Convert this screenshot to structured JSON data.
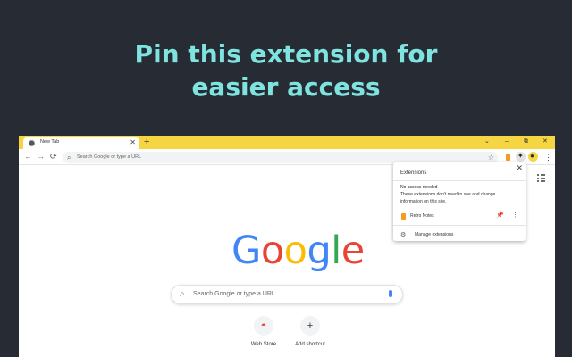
{
  "headline": {
    "line1": "Pin this extension for",
    "line2": "easier access"
  },
  "browser": {
    "tab": {
      "title": "New Tab",
      "close": "✕"
    },
    "newtab": "+",
    "window_controls": {
      "chevron": "⌄",
      "minimize": "–",
      "restore": "⧉",
      "close": "✕"
    },
    "nav": {
      "back": "←",
      "forward": "→",
      "reload": "⟳"
    },
    "omnibox": {
      "search_glyph": "⌕",
      "placeholder": "Search Google or type a URL",
      "star": "☆"
    },
    "toolbar_glyphs": {
      "puzzle": "✦",
      "profile": "●",
      "menu": "⋮"
    }
  },
  "newtab_page": {
    "logo": [
      {
        "ch": "G",
        "color": "#4285f4"
      },
      {
        "ch": "o",
        "color": "#ea4335"
      },
      {
        "ch": "o",
        "color": "#fbbc05"
      },
      {
        "ch": "g",
        "color": "#4285f4"
      },
      {
        "ch": "l",
        "color": "#34a853"
      },
      {
        "ch": "e",
        "color": "#ea4335"
      }
    ],
    "search": {
      "glyph": "⌕",
      "placeholder": "Search Google or type a URL"
    },
    "shortcuts": [
      {
        "label": "Web Store",
        "glyph": "◓"
      },
      {
        "label": "Add shortcut",
        "glyph": "+"
      }
    ]
  },
  "extensions_popup": {
    "close": "✕",
    "title": "Extensions",
    "section_title": "No access needed",
    "section_desc": "These extensions don't need to see and change information on this site.",
    "items": [
      {
        "name": "Retro Notes",
        "pin_glyph": "📌",
        "more_glyph": "⋮"
      }
    ],
    "manage_glyph": "⚙",
    "manage_label": "Manage extensions"
  },
  "colors": {
    "headline": "#7fe3e0",
    "background": "#272b33",
    "tabstrip": "#f6d542",
    "pin": "#1a73e8",
    "extension": "#f59a23"
  },
  "icons": [
    "chrome-favicon",
    "back-icon",
    "forward-icon",
    "reload-icon",
    "search-icon",
    "star-icon",
    "extension-icon",
    "puzzle-icon",
    "profile-icon",
    "menu-icon",
    "apps-grid-icon",
    "mic-icon",
    "pin-icon",
    "gear-icon",
    "close-icon"
  ]
}
